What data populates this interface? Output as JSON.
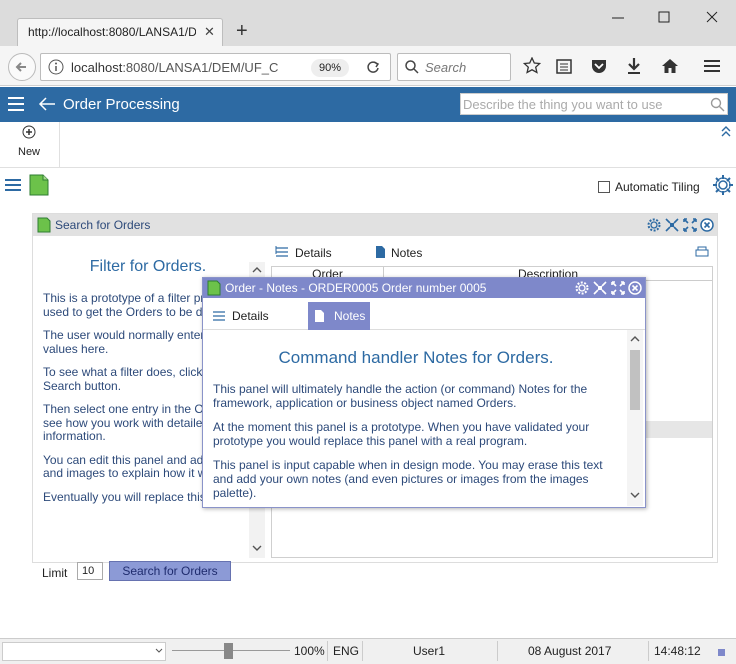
{
  "browser": {
    "tab_title": "http://localhost:8080/LANSA1/DEM/UF_C",
    "url_host": "localhost",
    "url_path": ":8080/LANSA1/DEM/UF_C",
    "zoom": "90%",
    "search_placeholder": "Search"
  },
  "app": {
    "title": "Order Processing",
    "describe_placeholder": "Describe the thing you want to use",
    "new_label": "New",
    "auto_tiling_label": "Automatic Tiling"
  },
  "search_panel": {
    "title": "Search for Orders",
    "filter_title": "Filter for Orders.",
    "paragraphs": [
      "This is a prototype of a filter program used to get the Orders to be displayed.",
      "The user would normally enter search values here.",
      "To see what a filter does, click the Search button.",
      "Then select one entry in the Orders to see how you work with detailed information.",
      "You can edit this panel and add notes and images to explain how it will work.",
      "Eventually you will replace this"
    ],
    "limit_label": "Limit",
    "limit_value": "10",
    "search_button": "Search for Orders",
    "tabs": [
      "Details",
      "Notes"
    ],
    "columns": [
      "Order",
      "Description"
    ]
  },
  "dialog": {
    "title": "Order - Notes - ORDER0005 Order number 0005",
    "tabs": [
      "Details",
      "Notes"
    ],
    "heading": "Command handler Notes for Orders.",
    "paragraphs": [
      "This panel will ultimately handle the action (or command) Notes for the framework, application or business object named Orders.",
      "At the moment this panel is a prototype. When you have validated your prototype you would replace this panel with a real program.",
      "This panel is input capable when in design mode. You may erase this text and add your own notes (and even pictures or images from the images palette)."
    ]
  },
  "status_bar": {
    "zoom": "100%",
    "language": "ENG",
    "user": "User1",
    "date": "08 August 2017",
    "time": "14:48:12"
  },
  "colors": {
    "header_blue": "#2d6aa3",
    "dialog_purple": "#7e88ca",
    "button_purple": "#8c9ad6",
    "doc_green": "#4caf50"
  }
}
